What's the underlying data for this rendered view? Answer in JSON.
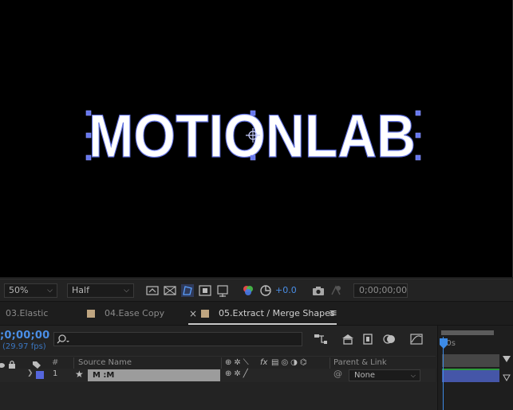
{
  "composition": {
    "text": "MOTIONLAB"
  },
  "viewer_bar": {
    "zoom": "50%",
    "resolution": "Half",
    "exposure": "+0.0",
    "timecode": "0;00;00;00"
  },
  "tabs": [
    {
      "label": "03.Elastic",
      "active": false
    },
    {
      "label": "04.Ease Copy",
      "active": false
    },
    {
      "label": "05.Extract / Merge Shapes",
      "active": true
    }
  ],
  "timeline": {
    "current_time": ";0;00;00",
    "fps": "(29.97 fps)",
    "ruler_label": "00s",
    "columns": {
      "index": "#",
      "source_name": "Source Name",
      "parent_link": "Parent & Link"
    },
    "layer": {
      "index": "1",
      "name": "M :M",
      "parent": "None"
    }
  },
  "colors": {
    "label_swatch": "#5566dd",
    "tab_swatch": "#bfa580",
    "accent_blue": "#4a8ee6",
    "layer_bar": "#4556a8"
  }
}
